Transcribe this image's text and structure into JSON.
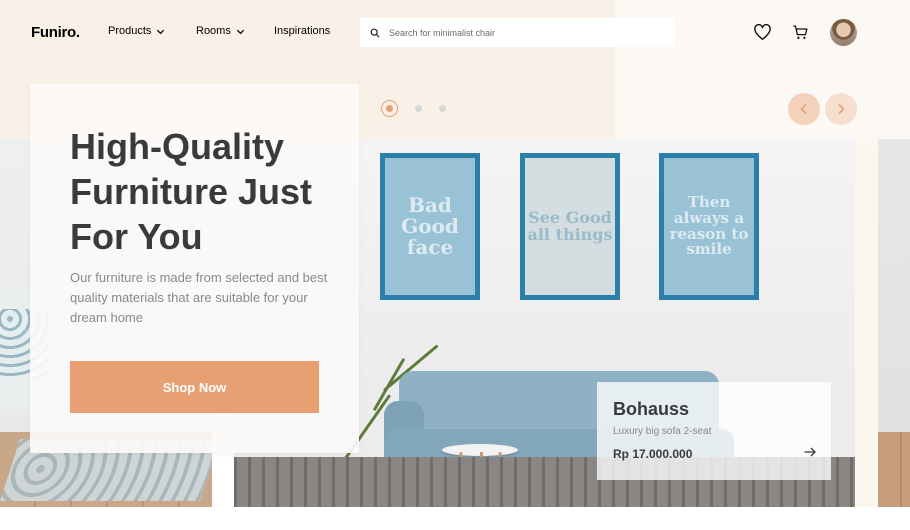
{
  "brand": {
    "logo": "Funiro."
  },
  "nav": {
    "items": [
      {
        "label": "Products",
        "has_dropdown": true
      },
      {
        "label": "Rooms",
        "has_dropdown": true
      },
      {
        "label": "Inspirations",
        "has_dropdown": false
      }
    ]
  },
  "search": {
    "placeholder": "Search for minimalist chair",
    "icon": "search-icon"
  },
  "actions": {
    "wishlist_icon": "heart-icon",
    "cart_icon": "cart-icon",
    "avatar": "user-avatar"
  },
  "hero": {
    "title": "High-Quality Furniture Just For You",
    "description": "Our furniture is made from selected and best quality materials that are suitable for your dream home",
    "cta_label": "Shop Now"
  },
  "slider": {
    "total_slides": 3,
    "active_index": 0
  },
  "wall_art": [
    {
      "text": "Bad Good face"
    },
    {
      "text": "See Good all things"
    },
    {
      "text": "Then always a reason to smile"
    }
  ],
  "product": {
    "name": "Bohauss",
    "subtitle": "Luxury big sofa 2-seat",
    "price": "Rp 17.000.000"
  },
  "colors": {
    "accent": "#e89f71",
    "accent_light": "#f4d1bb",
    "hero_title": "#3a3a3a",
    "muted_text": "#898989",
    "top_bg": "#f9f1e7",
    "frame_blue": "#2c7fa8"
  }
}
